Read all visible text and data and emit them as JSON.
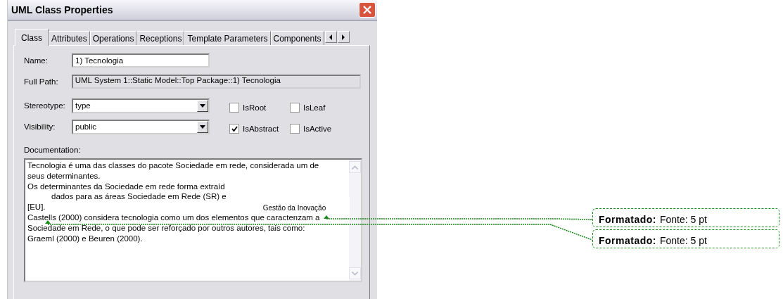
{
  "window": {
    "title": "UML Class Properties"
  },
  "tabs": [
    {
      "label": "Class",
      "selected": true
    },
    {
      "label": "Attributes",
      "selected": false
    },
    {
      "label": "Operations",
      "selected": false
    },
    {
      "label": "Receptions",
      "selected": false
    },
    {
      "label": "Template Parameters",
      "selected": false
    },
    {
      "label": "Components",
      "selected": false
    }
  ],
  "fields": [
    {
      "kind": "input",
      "label": "Name:",
      "value": "1) Tecnologia"
    },
    {
      "kind": "readonly",
      "label": "Full Path:",
      "value": "UML System 1::Static Model::Top Package::1) Tecnologia"
    }
  ],
  "dropdowns": [
    {
      "label": "Stereotype:",
      "value": "type"
    },
    {
      "label": "Visibility:",
      "value": "public"
    }
  ],
  "checkboxes": [
    {
      "label": "IsRoot",
      "checked": false
    },
    {
      "label": "IsLeaf",
      "checked": false
    },
    {
      "label": "IsAbstract",
      "checked": true
    },
    {
      "label": "IsActive",
      "checked": false
    }
  ],
  "documentation": {
    "label": "Documentation:",
    "lines": [
      "Tecnologia é uma das classes do pacote Sociedade em rede, considerada um de",
      "seus determinantes.",
      "Os determinantes da Sociedade em rede forma extraíd",
      "dados para as áreas Sociedade em Rede (SR) e",
      "[EU].",
      "Castells (2000) considera tecnologia como um dos elementos que caracterizam a",
      "Sociedade em Rede, o que pode ser reforçado por outros autores, tais como:",
      "Graeml (2000) e Beuren (2000)."
    ],
    "overlay_text": "Gestão da Inovação"
  },
  "comments": [
    {
      "label": "Formatado:",
      "text": "Fonte: 5 pt"
    },
    {
      "label": "Formatado:",
      "text": "Fonte: 5 pt"
    }
  ]
}
